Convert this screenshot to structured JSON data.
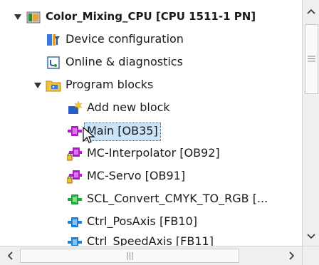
{
  "tree": {
    "root_label": "Color_Mixing_CPU [CPU 1511-1 PN]",
    "items": [
      {
        "label": "Device configuration"
      },
      {
        "label": "Online & diagnostics"
      },
      {
        "label": "Program blocks"
      },
      {
        "label": "Add new block"
      },
      {
        "label": "Main [OB35]"
      },
      {
        "label": "MC-Interpolator [OB92]"
      },
      {
        "label": "MC-Servo [OB91]"
      },
      {
        "label": "SCL_Convert_CMYK_TO_RGB [..."
      },
      {
        "label": "Ctrl_PosAxis [FB10]"
      },
      {
        "label": "Ctrl_SpeedAxis [FB11]"
      }
    ]
  },
  "colors": {
    "selection_bg": "#cbe3f6",
    "ob_icon": "#b21fc8",
    "fb_icon": "#1e7fd6",
    "scl_icon": "#1fa83a"
  }
}
